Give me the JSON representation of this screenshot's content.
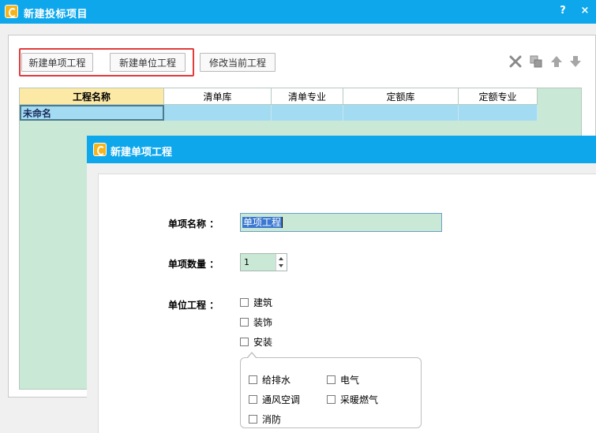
{
  "window": {
    "title": "新建投标项目",
    "help_label": "?",
    "close_label": "×"
  },
  "toolbar": {
    "new_single_label": "新建单项工程",
    "new_unit_label": "新建单位工程",
    "modify_label": "修改当前工程",
    "icons": [
      "delete-icon",
      "copy-icon",
      "move-up-icon",
      "move-down-icon"
    ],
    "highlight_color": "#e33a3a"
  },
  "grid": {
    "columns": [
      "工程名称",
      "清单库",
      "清单专业",
      "定额库",
      "定额专业"
    ],
    "rows": [
      {
        "name": "未命名",
        "list_lib": "",
        "list_major": "",
        "quota_lib": "",
        "quota_major": ""
      }
    ]
  },
  "dialog": {
    "title": "新建单项工程",
    "name_label": "单项名称 ：",
    "name_value": "单项工程",
    "count_label": "单项数量 ：",
    "count_value": "1",
    "unit_label": "单位工程 ：",
    "units": [
      "建筑",
      "装饰",
      "安装"
    ],
    "install_subitems": [
      "给排水",
      "电气",
      "通风空调",
      "采暖燃气",
      "消防"
    ]
  },
  "colors": {
    "title_bar": "#0ea7ec",
    "grid_bg": "#c9e8d5",
    "selected_row": "#a3dcf2",
    "header_first": "#fde9a6"
  }
}
